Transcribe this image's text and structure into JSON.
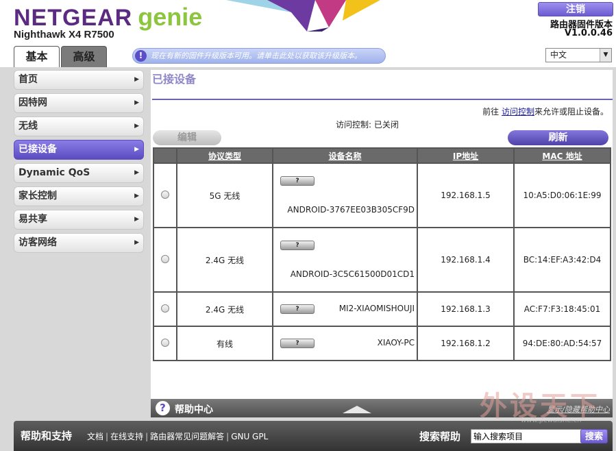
{
  "header": {
    "brand": "NETGEAR",
    "brand_suffix": "genie",
    "model": "Nighthawk X4 R7500",
    "logout_label": "注销",
    "firmware_label": "路由器固件版本",
    "firmware_version": "V1.0.0.46",
    "tabs": [
      {
        "label": "基本",
        "active": true
      },
      {
        "label": "高级",
        "active": false
      }
    ],
    "firmware_notice": "现在有新的固件升级版本可用。请单击此处以获取该升级版本。",
    "language": "中文",
    "brand_color": "#5b2b82",
    "genie_color": "#8cc63f"
  },
  "sidebar": {
    "items": [
      {
        "label": "首页",
        "active": false
      },
      {
        "label": "因特网",
        "active": false
      },
      {
        "label": "无线",
        "active": false
      },
      {
        "label": "已接设备",
        "active": true
      },
      {
        "label": "Dynamic QoS",
        "active": false
      },
      {
        "label": "家长控制",
        "active": false
      },
      {
        "label": "易共享",
        "active": false
      },
      {
        "label": "访客网络",
        "active": false
      }
    ]
  },
  "main": {
    "title": "已接设备",
    "access_note_prefix": "前往",
    "access_note_link": "访问控制",
    "access_note_suffix": "来允许或阻止设备。",
    "access_status": "访问控制: 已关闭",
    "edit_label": "编辑",
    "refresh_label": "刷新",
    "table": {
      "headers": [
        "协议类型",
        "设备名称",
        "IP地址",
        "MAC 地址"
      ],
      "rows": [
        {
          "type": "5G 无线",
          "name": "ANDROID-3767EE03B305CF9D",
          "ip": "192.168.1.5",
          "mac": "10:A5:D0:06:1E:99",
          "icon": "?"
        },
        {
          "type": "2.4G 无线",
          "name": "ANDROID-3C5C61500D01CD1",
          "ip": "192.168.1.4",
          "mac": "BC:14:EF:A3:42:D4",
          "icon": "?"
        },
        {
          "type": "2.4G 无线",
          "name": "MI2-XIAOMISHOUJI",
          "ip": "192.168.1.3",
          "mac": "AC:F7:F3:18:45:01",
          "icon": "?"
        },
        {
          "type": "有线",
          "name": "XIAOY-PC",
          "ip": "192.168.1.2",
          "mac": "94:DE:80:AD:54:57",
          "icon": "?"
        }
      ]
    }
  },
  "help": {
    "title": "帮助中心",
    "toggle": "显示/隐藏帮助中心"
  },
  "footer": {
    "title": "帮助和支持",
    "links": [
      "文档",
      "在线支持",
      "路由器常见问题解答",
      "GNU GPL"
    ],
    "search_label": "搜索帮助",
    "search_placeholder": "输入搜索项目",
    "search_button": "搜索"
  },
  "watermark": {
    "text": "外设天下",
    "url": "www.pcwaishe.cn"
  }
}
